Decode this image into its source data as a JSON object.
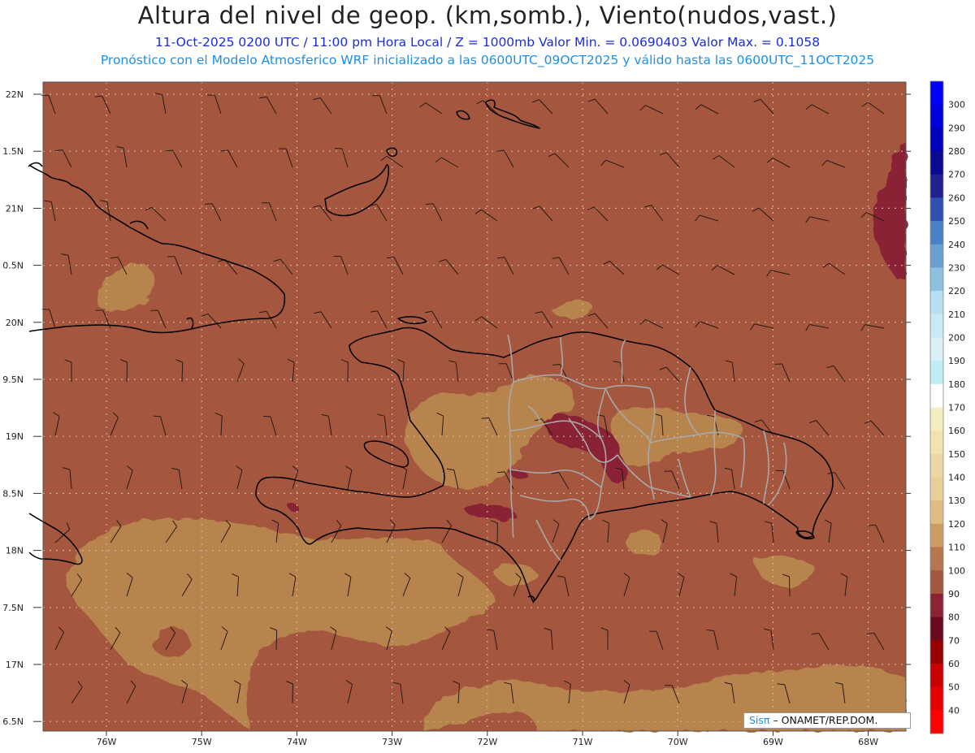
{
  "header": {
    "title": "Altura del nivel de geop. (km,somb.), Viento(nudos,vast.)",
    "line1": "11-Oct-2025 0200 UTC / 11:00 pm Hora Local / Z = 1000mb  Valor Min. = 0.0690403  Valor Max. = 0.1058",
    "line2": "Pronóstico con el Modelo Atmosferico WRF inicializado a las 0600UTC_09OCT2025 y válido hasta las  0600UTC_11OCT2025"
  },
  "axes": {
    "lat_labels": [
      "22N",
      "1.5N",
      "21N",
      "0.5N",
      "20N",
      "9.5N",
      "19N",
      "8.5N",
      "18N",
      "7.5N",
      "17N",
      "6.5N"
    ],
    "lon_labels": [
      "76W",
      "75W",
      "74W",
      "73W",
      "72W",
      "71W",
      "70W",
      "69W",
      "68W"
    ]
  },
  "colorbar": {
    "labels": [
      "300",
      "290",
      "280",
      "270",
      "260",
      "250",
      "240",
      "230",
      "220",
      "210",
      "200",
      "190",
      "180",
      "170",
      "160",
      "150",
      "140",
      "130",
      "120",
      "110",
      "100",
      "90",
      "80",
      "70",
      "60",
      "50",
      "40"
    ],
    "colors": [
      "#0000ff",
      "#0000dd",
      "#0000bb",
      "#0a0a90",
      "#202090",
      "#3050b0",
      "#4a80c4",
      "#6aa0d0",
      "#90c0e0",
      "#b8e0f0",
      "#c8eaf4",
      "#d8f0f8",
      "#c0ecf6",
      "#ffffff",
      "#f6ecc4",
      "#f2e2b2",
      "#ecd8a4",
      "#e8ce98",
      "#dfbc86",
      "#cd9c64",
      "#b67650",
      "#a4563e",
      "#8a2434",
      "#6a0a20",
      "#960000",
      "#c80000",
      "#e60000",
      "#ff0000"
    ]
  },
  "credit": {
    "brand": "Sisπ",
    "text": "– ONAMET/REP.DOM."
  }
}
